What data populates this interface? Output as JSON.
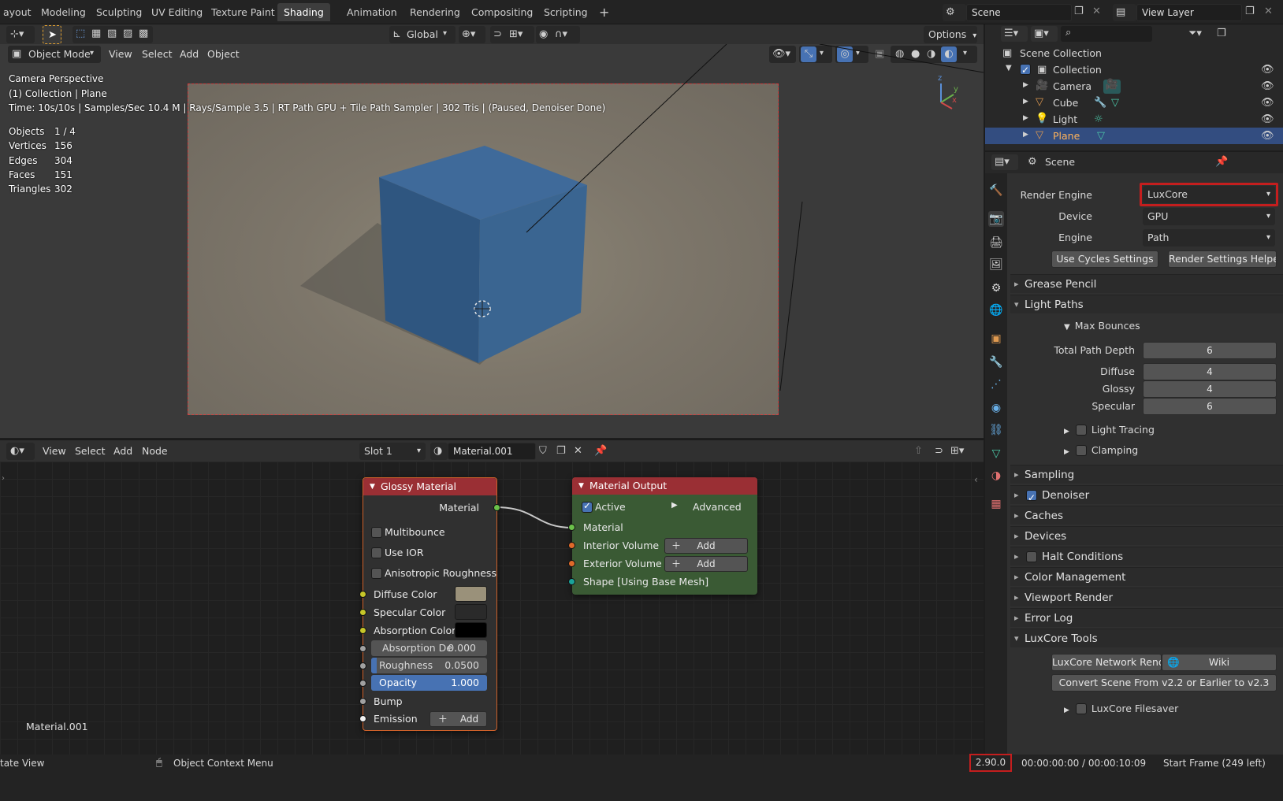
{
  "topbar": {
    "workspaces": [
      "ayout",
      "Modeling",
      "Sculpting",
      "UV Editing",
      "Texture Paint",
      "Shading",
      "Animation",
      "Rendering",
      "Compositing",
      "Scripting"
    ],
    "active_workspace": "Shading",
    "add_workspace": "+",
    "scene": "Scene",
    "view_layer": "View Layer"
  },
  "tool_header": {
    "orientation": "Global",
    "options": "Options"
  },
  "viewport": {
    "mode": "Object Mode",
    "menus": [
      "View",
      "Select",
      "Add",
      "Object"
    ],
    "overlay_title": "Camera Perspective",
    "overlay_collection": "(1) Collection | Plane",
    "overlay_time": "Time: 10s/10s | Samples/Sec 10.4 M | Rays/Sample 3.5 | RT Path GPU + Tile Path Sampler | 302 Tris | (Paused, Denoiser Done)",
    "stats": [
      {
        "label": "Objects",
        "value": "1 / 4"
      },
      {
        "label": "Vertices",
        "value": "156"
      },
      {
        "label": "Edges",
        "value": "304"
      },
      {
        "label": "Faces",
        "value": "151"
      },
      {
        "label": "Triangles",
        "value": "302"
      }
    ],
    "gizmo": {
      "z": "z",
      "y": "y",
      "x": "x"
    }
  },
  "node_editor": {
    "menus": [
      "View",
      "Select",
      "Add",
      "Node"
    ],
    "slot": "Slot 1",
    "material": "Material.001",
    "material_label": "Material.001",
    "glossy": {
      "title": "Glossy Material",
      "output": "Material",
      "multibounce": "Multibounce",
      "use_ior": "Use IOR",
      "aniso": "Anisotropic Roughness",
      "diffuse_color": "Diffuse Color",
      "diffuse_color_hex": "#9a917a",
      "specular_color": "Specular Color",
      "specular_color_hex": "#2a2a2a",
      "absorption_color": "Absorption Color",
      "absorption_color_hex": "#000000",
      "absorption_depth_label": "Absorption De",
      "absorption_depth_value": "0.000",
      "roughness_label": "Roughness",
      "roughness_value": "0.0500",
      "roughness_fraction": 0.05,
      "opacity_label": "Opacity",
      "opacity_value": "1.000",
      "opacity_fraction": 1.0,
      "bump": "Bump",
      "emission": "Emission",
      "add": "Add"
    },
    "output": {
      "title": "Material Output",
      "active": "Active",
      "advanced": "Advanced",
      "material": "Material",
      "interior": "Interior Volume",
      "exterior": "Exterior Volume",
      "shape": "Shape [Using Base Mesh]",
      "add": "Add"
    }
  },
  "outliner": {
    "root": "Scene Collection",
    "collection": "Collection",
    "items": [
      {
        "name": "Camera",
        "icon": "camera-icon"
      },
      {
        "name": "Cube",
        "icon": "mesh-icon"
      },
      {
        "name": "Light",
        "icon": "light-icon"
      },
      {
        "name": "Plane",
        "icon": "mesh-icon",
        "selected": true
      }
    ]
  },
  "properties": {
    "context": "Scene",
    "render_engine_label": "Render Engine",
    "render_engine": "LuxCore",
    "device_label": "Device",
    "device": "GPU",
    "engine_label": "Engine",
    "engine": "Path",
    "use_cycles": "Use Cycles Settings",
    "helper": "Render Settings Helper",
    "panels": {
      "grease_pencil": "Grease Pencil",
      "light_paths": "Light Paths",
      "max_bounces": "Max Bounces",
      "total_path_depth": "Total Path Depth",
      "total_path_depth_value": "6",
      "diffuse": "Diffuse",
      "diffuse_value": "4",
      "glossy": "Glossy",
      "glossy_value": "4",
      "specular": "Specular",
      "specular_value": "6",
      "light_tracing": "Light Tracing",
      "clamping": "Clamping",
      "sampling": "Sampling",
      "denoiser": "Denoiser",
      "caches": "Caches",
      "devices": "Devices",
      "halt": "Halt Conditions",
      "color_mgmt": "Color Management",
      "viewport_render": "Viewport Render",
      "error_log": "Error Log",
      "luxcore_tools": "LuxCore Tools",
      "network_render": "LuxCore Network Render",
      "wiki": "Wiki",
      "convert": "Convert Scene From v2.2 or Earlier to v2.3",
      "filesaver": "LuxCore Filesaver"
    }
  },
  "status": {
    "left": "tate View",
    "context_menu": "Object Context Menu",
    "version": "2.90.0",
    "time": "00:00:00:00 / 00:00:10:09",
    "start_frame": "Start Frame (249 left)"
  },
  "colors": {
    "accent": "#4772b3",
    "highlight_red": "#c41e1e",
    "node_output_green": "#3a5a34",
    "node_header_red": "#b0343a"
  }
}
